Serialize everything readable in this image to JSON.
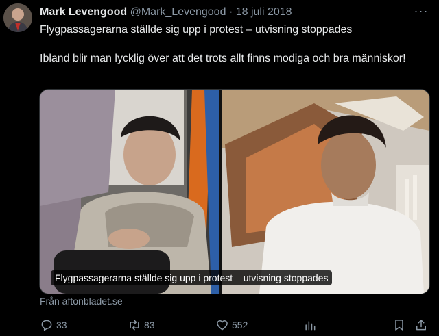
{
  "author": {
    "display_name": "Mark Levengood",
    "handle": "@Mark_Levengood",
    "separator": "·",
    "date": "18 juli 2018",
    "avatar_icon": "profile-photo"
  },
  "tweet": {
    "line1": "Flygpassagerarna ställde sig upp i protest – utvisning stoppades",
    "line2": "Ibland blir man lycklig över att det trots allt finns modiga och bra människor!"
  },
  "card": {
    "caption": "Flygpassagerarna ställde sig upp i protest – utvisning stoppades",
    "source": "Från aftonbladet.se"
  },
  "actions": {
    "replies": "33",
    "reposts": "83",
    "likes": "552"
  },
  "icons": {
    "more": "more-icon",
    "reply": "reply-icon",
    "repost": "repost-icon",
    "like": "heart-icon",
    "views": "views-icon",
    "bookmark": "bookmark-icon",
    "share": "share-icon"
  },
  "colors": {
    "background": "#000000",
    "text": "#e7e9ea",
    "muted": "#8b98a5"
  }
}
